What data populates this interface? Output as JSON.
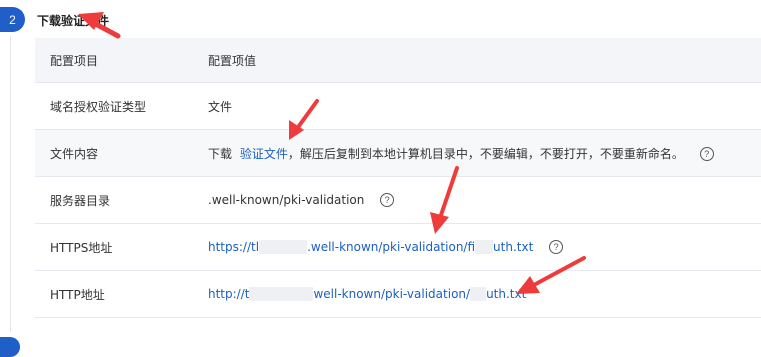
{
  "step": {
    "number": "2",
    "title": "下载验证文件"
  },
  "table": {
    "headers": {
      "key": "配置项目",
      "value": "配置项值"
    },
    "rows": {
      "domain_type": {
        "key": "域名授权验证类型",
        "value": "文件"
      },
      "file_content": {
        "key": "文件内容",
        "prefix": "下载",
        "link": "验证文件",
        "suffix": "，解压后复制到本地计算机目录中，不要编辑，不要打开，不要重新命名。"
      },
      "server_dir": {
        "key": "服务器目录",
        "value": ".well-known/pki-validation"
      },
      "https_url": {
        "key": "HTTPS地址",
        "part1": "https://tl",
        "part2": ".well-known/pki-validation/fi",
        "part3": "uth.txt"
      },
      "http_url": {
        "key": "HTTP地址",
        "part1": "http://t",
        "part2": "well-known/pki-validation/",
        "part3": "uth.txt"
      }
    }
  },
  "icons": {
    "help": "question-circle-icon",
    "annotation": "red-arrow-icon"
  },
  "colors": {
    "accent": "#1f5fc7",
    "link": "#1b5fc2",
    "header_bg": "#f3f5f8",
    "annotation": "#ee3b3b"
  }
}
